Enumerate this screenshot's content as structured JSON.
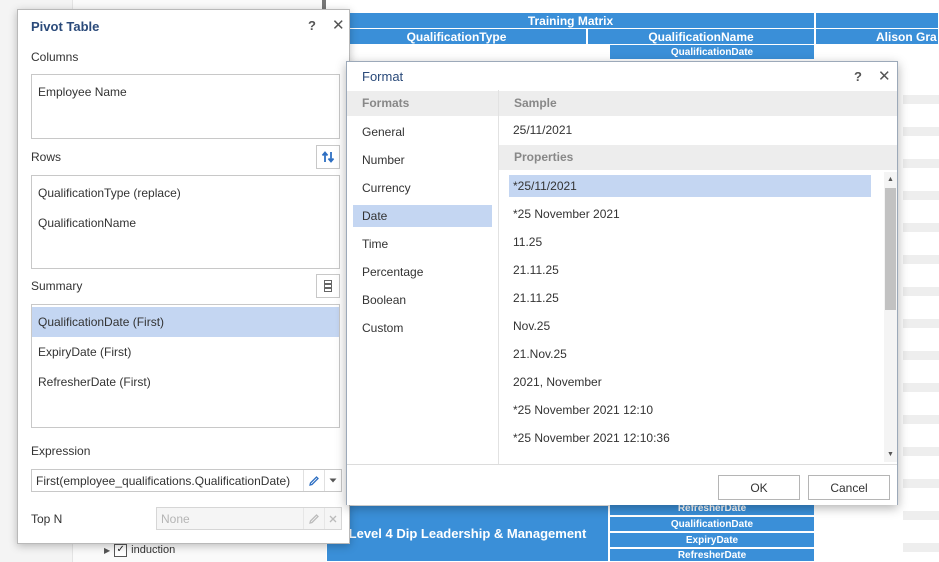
{
  "matrix": {
    "title": "Training Matrix",
    "col_type": "QualificationType",
    "col_name": "QualificationName",
    "col_date": "QualificationDate",
    "col_employee": "Alison Gra",
    "bottom_group": "Level 4 Dip Leadership & Management",
    "bottom_rows": [
      "RefresherDate",
      "QualificationDate",
      "ExpiryDate",
      "RefresherDate"
    ]
  },
  "tree": {
    "item_label": "induction",
    "check_glyph": "✓"
  },
  "pivot": {
    "title": "Pivot Table",
    "help": "?",
    "close": "✕",
    "columns_label": "Columns",
    "columns": [
      "Employee Name"
    ],
    "rows_label": "Rows",
    "rows": [
      "QualificationType (replace)",
      "QualificationName"
    ],
    "summary_label": "Summary",
    "summary": [
      "QualificationDate (First)",
      "ExpiryDate (First)",
      "RefresherDate (First)"
    ],
    "expression_label": "Expression",
    "expression_value": "First(employee_qualifications.QualificationDate)",
    "topn_label": "Top N",
    "topn_placeholder": "None"
  },
  "format": {
    "title": "Format",
    "help": "?",
    "close": "✕",
    "formats_header": "Formats",
    "formats": [
      "General",
      "Number",
      "Currency",
      "Date",
      "Time",
      "Percentage",
      "Boolean",
      "Custom"
    ],
    "selected_format": "Date",
    "sample_header": "Sample",
    "sample_value": "25/11/2021",
    "properties_header": "Properties",
    "properties": [
      "*25/11/2021",
      "*25 November 2021",
      "11.25",
      "21.11.25",
      "21.11.25",
      "Nov.25",
      "21.Nov.25",
      "2021, November",
      "*25 November 2021 12:10",
      "*25 November 2021 12:10:36"
    ],
    "ok_label": "OK",
    "cancel_label": "Cancel"
  },
  "colors": {
    "matrix_blue": "#3a8fd8",
    "selection": "#c4d6f2",
    "title_blue": "#2a4a7a",
    "swap_icon_blue": "#2e6fc2"
  },
  "icons": [
    "swap-rows-icon",
    "column-list-icon",
    "edit-pencil-icon",
    "dropdown-arrow-icon",
    "clear-icon",
    "scroll-up-icon",
    "scroll-down-icon"
  ]
}
